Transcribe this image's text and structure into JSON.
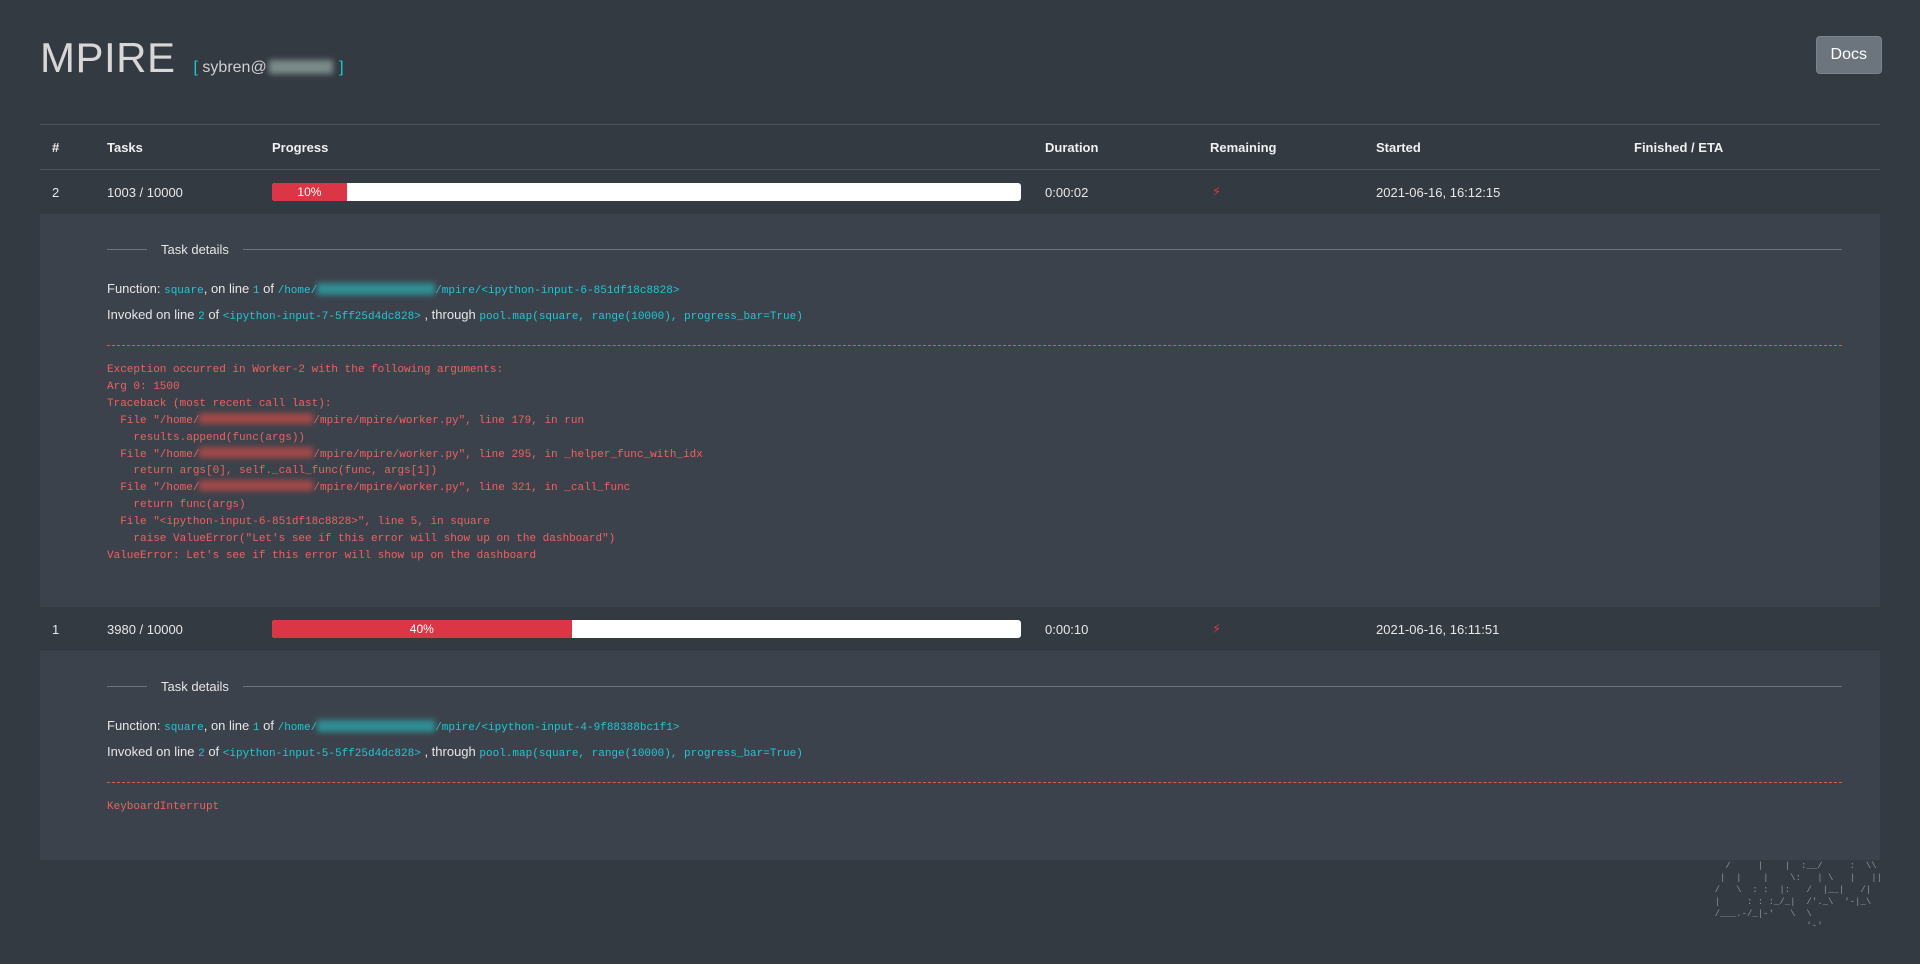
{
  "header": {
    "title": "MPIRE",
    "user_prefix": "[",
    "user": "sybren@",
    "user_suffix": "]",
    "docs_label": "Docs"
  },
  "table": {
    "columns": [
      "#",
      "Tasks",
      "Progress",
      "Duration",
      "Remaining",
      "Started",
      "Finished / ETA"
    ]
  },
  "jobs": [
    {
      "id": "2",
      "tasks": "1003 / 10000",
      "progress_label": "10%",
      "progress": 0.1,
      "duration": "0:00:02",
      "remaining_icon": "lightning-icon",
      "started": "2021-06-16, 16:12:15",
      "finished": "",
      "details": {
        "legend": "Task details",
        "function_label": "Function:",
        "function_name": "square",
        "on_line_label": ", on line",
        "function_line": "1",
        "of_label": "of",
        "path_prefix": "/home/",
        "path_suffix": "/mpire/<ipython-input-6-851df18c8828>",
        "invoked_label": "Invoked on line",
        "invoked_line": "2",
        "invoked_of_label": "of",
        "invoked_file": "<ipython-input-7-5ff25d4dc828>",
        "through_label": ", through",
        "through_code": "pool.map(square, range(10000), progress_bar=True)",
        "error_lines": [
          "Exception occurred in Worker-2 with the following arguments:",
          "Arg 0: 1500",
          "Traceback (most recent call last):",
          "  File \"/home/",
          "/mpire/mpire/worker.py\", line 179, in run",
          "    results.append(func(args))",
          "  File \"/home/",
          "/mpire/mpire/worker.py\", line 295, in _helper_func_with_idx",
          "    return args[0], self._call_func(func, args[1])",
          "  File \"/home/",
          "/mpire/mpire/worker.py\", line 321, in _call_func",
          "    return func(args)",
          "  File \"<ipython-input-6-851df18c8828>\", line 5, in square",
          "    raise ValueError(\"Let's see if this error will show up on the dashboard\")",
          "ValueError: Let's see if this error will show up on the dashboard"
        ]
      }
    },
    {
      "id": "1",
      "tasks": "3980 / 10000",
      "progress_label": "40%",
      "progress": 0.4,
      "duration": "0:00:10",
      "remaining_icon": "lightning-icon",
      "started": "2021-06-16, 16:11:51",
      "finished": "",
      "details": {
        "legend": "Task details",
        "function_label": "Function:",
        "function_name": "square",
        "on_line_label": ", on line",
        "function_line": "1",
        "of_label": "of",
        "path_prefix": "/home/",
        "path_suffix": "/mpire/<ipython-input-4-9f88388bc1f1>",
        "invoked_label": "Invoked on line",
        "invoked_line": "2",
        "invoked_of_label": "of",
        "invoked_file": "<ipython-input-5-5ff25d4dc828>",
        "through_label": ", through",
        "through_code": "pool.map(square, range(10000), progress_bar=True)",
        "error": "KeyboardInterrupt"
      }
    }
  ],
  "ascii_art": "   /     |    |  :__/     :  \\\\\n  |  |    |    \\:   | \\   |   ||\n /   \\  : :  |:   /  |__|   /|\n |     : : :_/_|  /'._\\  '-|_\\\n /___.-/_|-'   \\  \\\n                  '-'"
}
